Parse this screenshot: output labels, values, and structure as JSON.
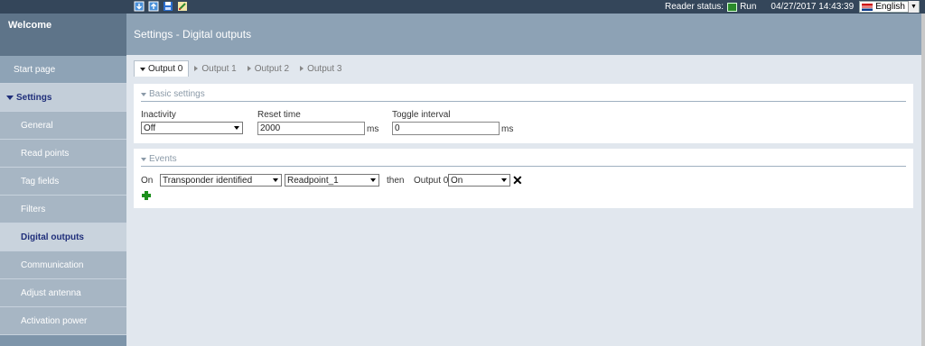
{
  "topbar": {
    "icons": [
      "download-icon",
      "upload-icon",
      "save-icon",
      "edit-icon"
    ],
    "reader_status_label": "Reader status:",
    "reader_status_value": "Run",
    "timestamp": "04/27/2017 14:43:39",
    "language": "English"
  },
  "sidebar": {
    "welcome": "Welcome",
    "start_page": "Start page",
    "settings": "Settings",
    "items": [
      "General",
      "Read points",
      "Tag fields",
      "Filters",
      "Digital outputs",
      "Communication",
      "Adjust antenna",
      "Activation power"
    ]
  },
  "header": {
    "title": "Settings - Digital outputs"
  },
  "tabs": [
    "Output 0",
    "Output 1",
    "Output 2",
    "Output 3"
  ],
  "basic": {
    "title": "Basic settings",
    "inactivity_label": "Inactivity",
    "inactivity_value": "Off",
    "reset_label": "Reset time",
    "reset_value": "2000",
    "reset_unit": "ms",
    "toggle_label": "Toggle interval",
    "toggle_value": "0",
    "toggle_unit": "ms"
  },
  "events": {
    "title": "Events",
    "on_label": "On",
    "event_value": "Transponder identified",
    "readpoint_value": "Readpoint_1",
    "then_label": "then",
    "output_label": "Output 0",
    "state_value": "On"
  },
  "colors": {
    "topbar": "#34465a",
    "sidebar": "#7e95aa",
    "accent": "#1f2e7a",
    "add": "#1c8f1c"
  }
}
